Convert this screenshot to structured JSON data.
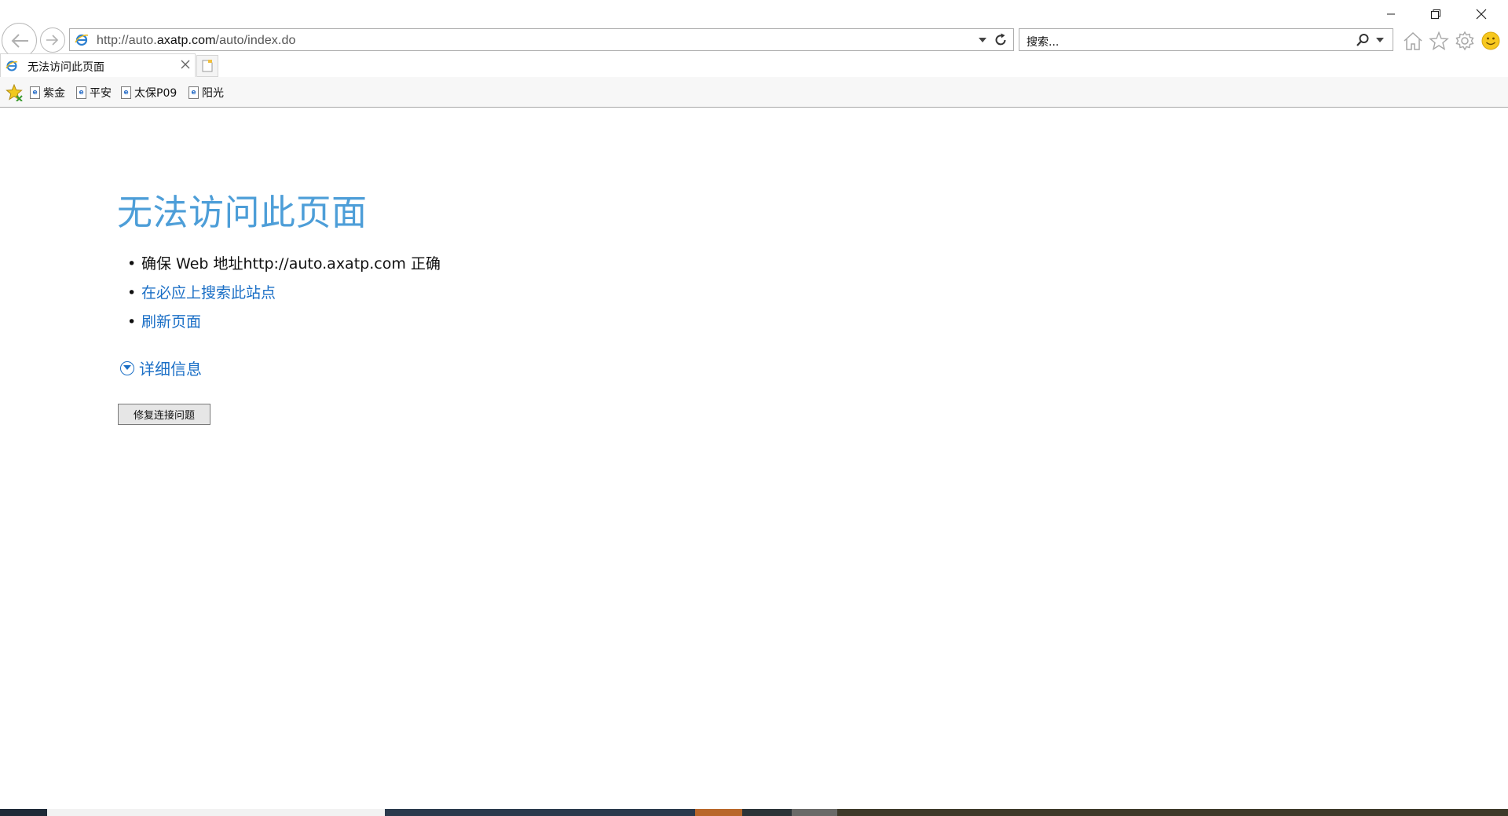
{
  "window": {
    "minimize_icon": "minimize-icon",
    "restore_icon": "restore-icon",
    "close_icon": "close-icon"
  },
  "addressbar": {
    "url_prefix": "http://auto.",
    "url_domain": "axatp.com",
    "url_suffix": "/auto/index.do"
  },
  "search": {
    "placeholder": "搜索..."
  },
  "tab": {
    "title": "无法访问此页面"
  },
  "favorites": [
    {
      "label": "紫金"
    },
    {
      "label": "平安"
    },
    {
      "label": "太保P09"
    },
    {
      "label": "阳光"
    }
  ],
  "error": {
    "headline": "无法访问此页面",
    "bullet1": "确保 Web 地址http://auto.axatp.com 正确",
    "bullet2": "在必应上搜索此站点",
    "bullet3": "刷新页面",
    "details": "详细信息",
    "fix_button": "修复连接问题"
  },
  "colors": {
    "headline": "#4d9ed8",
    "link": "#1b6fc6"
  }
}
